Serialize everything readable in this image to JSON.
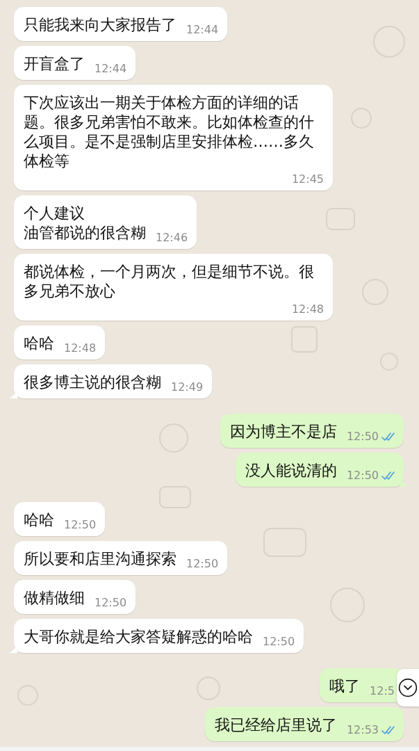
{
  "messages": [
    {
      "kind": "incoming",
      "text": "只能我来向大家报告了",
      "time": "12:44",
      "tail": false
    },
    {
      "kind": "incoming",
      "text": "开盲盒了",
      "time": "12:44",
      "tail": false
    },
    {
      "kind": "incoming",
      "text": "下次应该出一期关于体检方面的详细的话题。很多兄弟害怕不敢来。比如体检查的什么项目。是不是强制店里安排体检……多久体检等",
      "time": "12:45",
      "tail": false
    },
    {
      "kind": "incoming",
      "lines": [
        "个人建议",
        "油管都说的很含糊"
      ],
      "time": "12:46",
      "tail": false
    },
    {
      "kind": "incoming",
      "text": "都说体检，一个月两次，但是细节不说。很多兄弟不放心",
      "time": "12:48",
      "tail": false
    },
    {
      "kind": "incoming",
      "text": "哈哈",
      "time": "12:48",
      "tail": false
    },
    {
      "kind": "incoming",
      "text": "很多博主说的很含糊",
      "time": "12:49",
      "tail": true
    },
    {
      "kind": "outgoing",
      "text": "因为博主不是店",
      "time": "12:50",
      "tail": false,
      "read": true
    },
    {
      "kind": "outgoing",
      "text": "没人能说清的",
      "time": "12:50",
      "tail": true,
      "read": true
    },
    {
      "kind": "incoming",
      "text": "哈哈",
      "time": "12:50",
      "tail": false
    },
    {
      "kind": "incoming",
      "text": "所以要和店里沟通探索",
      "time": "12:50",
      "tail": false
    },
    {
      "kind": "incoming",
      "text": "做精做细",
      "time": "12:50",
      "tail": false
    },
    {
      "kind": "incoming",
      "text": "大哥你就是给大家答疑解惑的哈哈",
      "time": "12:50",
      "tail": true
    },
    {
      "kind": "outgoing",
      "text": "哦了",
      "time": "12:5",
      "tail": false
    },
    {
      "kind": "outgoing",
      "text": "我已经给店里说了",
      "time": "12:53",
      "tail": false,
      "read": true
    }
  ]
}
